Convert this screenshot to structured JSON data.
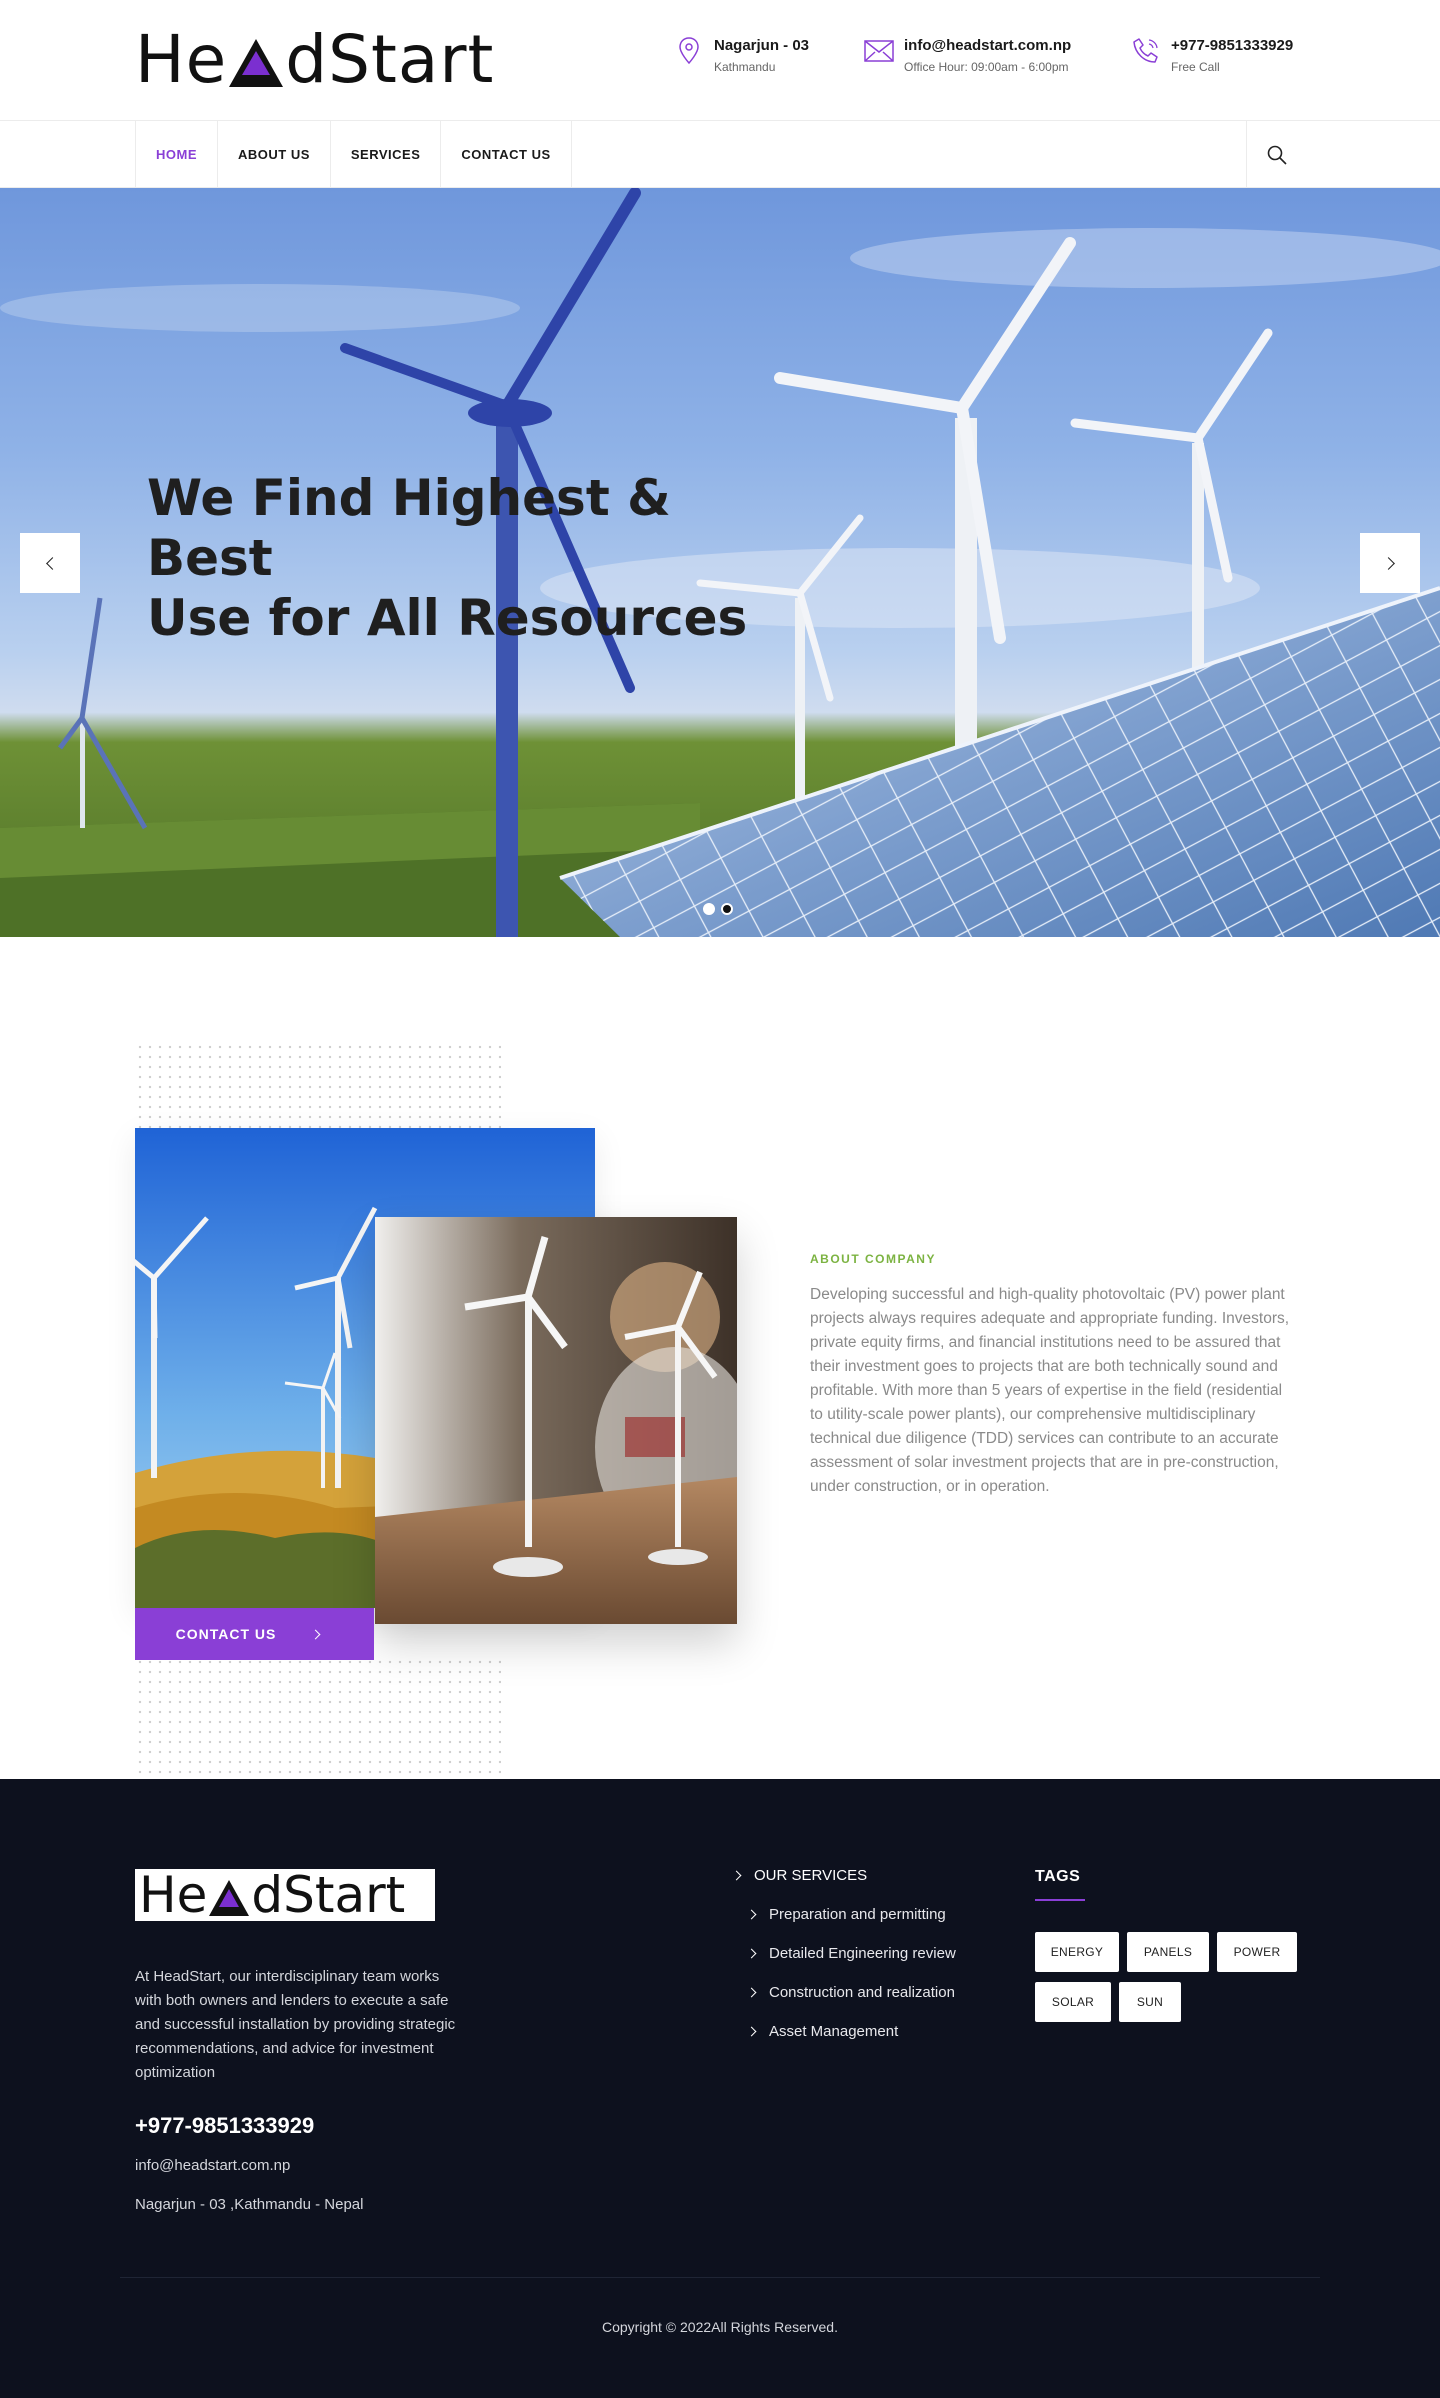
{
  "header": {
    "logo_text_left": "He",
    "logo_text_right": "dStart",
    "location": {
      "title": "Nagarjun - 03",
      "subtitle": "Kathmandu",
      "icon": "map-pin-icon"
    },
    "email": {
      "title": "info@headstart.com.np",
      "subtitle": "Office Hour: 09:00am - 6:00pm",
      "icon": "envelope-icon"
    },
    "phone": {
      "title": "+977-9851333929",
      "subtitle": "Free Call",
      "icon": "phone-icon"
    },
    "accent_color": "#8a3fd6"
  },
  "nav": {
    "items": [
      {
        "label": "HOME",
        "active": true
      },
      {
        "label": "ABOUT US",
        "active": false
      },
      {
        "label": "SERVICES",
        "active": false
      },
      {
        "label": "CONTACT US",
        "active": false
      }
    ],
    "search_icon": "search-icon"
  },
  "hero": {
    "title_line1": "We Find Highest & Best",
    "title_line2": "Use for All Resources",
    "prev_icon": "chevron-left-icon",
    "next_icon": "chevron-right-icon",
    "slides_total": 2,
    "active_slide": 2
  },
  "about": {
    "label": "ABOUT COMPANY",
    "label_color": "#7cb342",
    "text": "Developing successful and high-quality photovoltaic (PV) power plant projects always requires adequate and appropriate funding. Investors, private equity firms, and financial institutions need to be assured that their investment goes to projects that are both technically sound and profitable. With more than 5 years of expertise in the field (residential to utility-scale power plants), our comprehensive multidisciplinary technical due diligence (TDD) services can contribute to an accurate assessment of solar investment projects that are in pre-construction, under construction, or in operation.",
    "button_label": "CONTACT US"
  },
  "footer": {
    "description": "At HeadStart, our interdisciplinary team works with both owners and lenders to execute a safe and successful installation by providing strategic recommendations, and advice for investment optimization",
    "phone": "+977-9851333929",
    "email": "info@headstart.com.np",
    "address": "Nagarjun - 03 ,Kathmandu - Nepal",
    "services_title": "OUR SERVICES",
    "services": [
      "Preparation and permitting",
      "Detailed Engineering review",
      "Construction and realization",
      "Asset Management"
    ],
    "tags_title": "TAGS",
    "tags": [
      "ENERGY",
      "PANELS",
      "POWER",
      "SOLAR",
      "SUN"
    ],
    "copyright": "Copyright © 2022All Rights Reserved.",
    "background": "#0d111e"
  }
}
